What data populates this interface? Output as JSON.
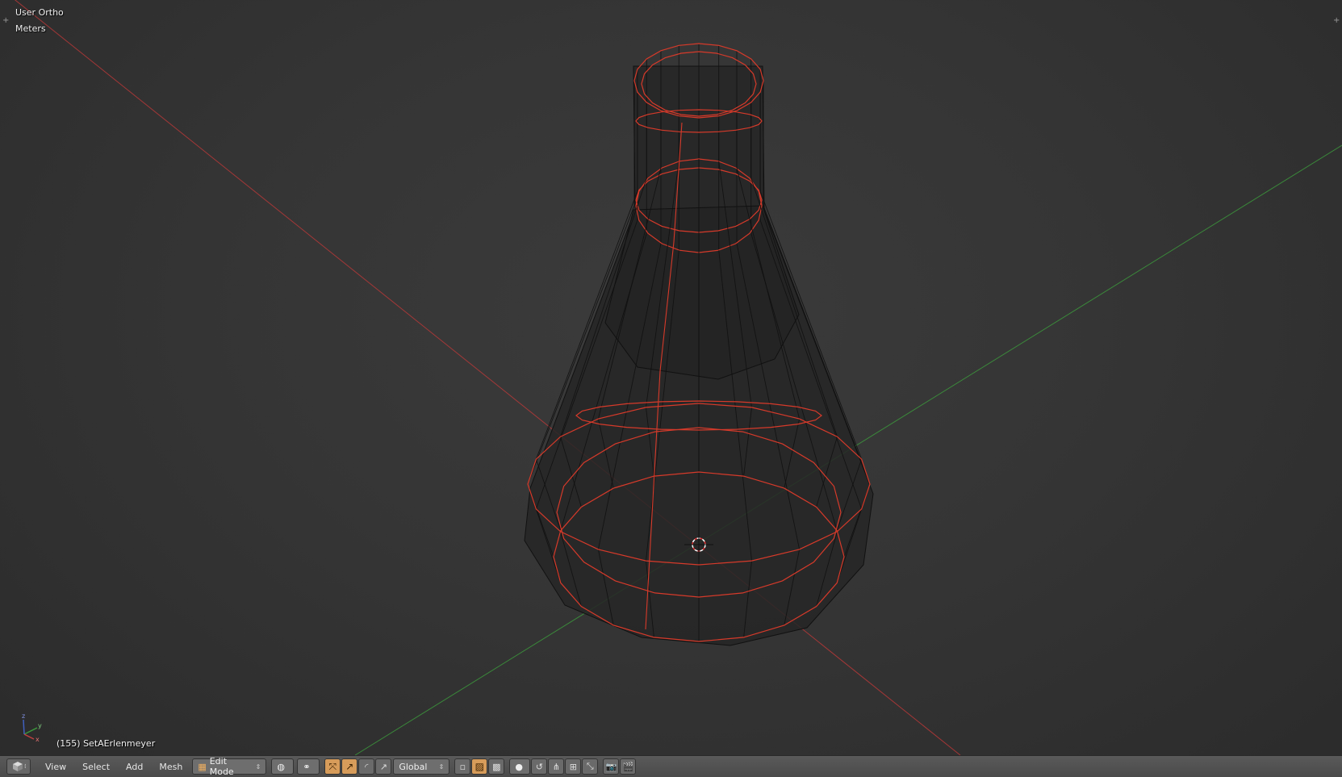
{
  "viewport": {
    "view_name": "User Ortho",
    "units": "Meters",
    "object_info": "(155) SetAErlenmeyer",
    "axes": {
      "x": "x",
      "y": "y",
      "z": "z"
    },
    "colors": {
      "x_axis": "#b83838",
      "y_axis": "#3c9a3c",
      "edge_selected": "#d63a2a",
      "edge": "#111111"
    }
  },
  "header": {
    "editor_type_icon": "3d-view-icon",
    "menus": [
      "View",
      "Select",
      "Add",
      "Mesh"
    ],
    "mode": "Edit Mode",
    "orientation": "Global",
    "icons": {
      "viewport_shading": "sphere-icon",
      "pivot": "pivot-icon",
      "manipulator_translate": "move-icon",
      "manipulator_rotate": "rotate-icon",
      "manipulator_scale": "scale-icon",
      "vertex_select": "vertex-select-icon",
      "edge_select": "edge-select-icon",
      "face_select": "face-select-icon",
      "proportional": "proportional-edit-icon",
      "snap": "magnet-icon",
      "render": "camera-icon",
      "layers": "layers-icon"
    }
  }
}
